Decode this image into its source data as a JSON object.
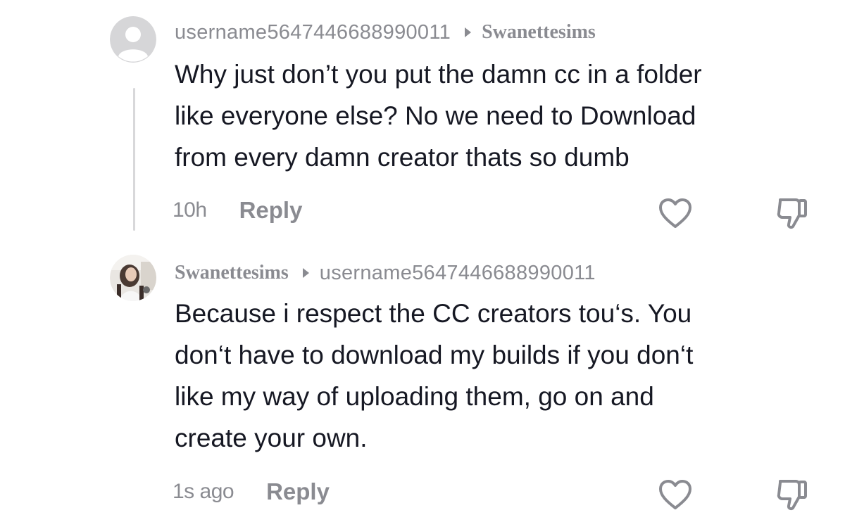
{
  "comments": [
    {
      "author": "username5647446688990011",
      "reply_to": "Swanettesims",
      "text": "Why just don’t you put the damn cc in a folder\nlike everyone else? No we need to Download\nfrom every damn creator thats so dumb",
      "time": "10h",
      "reply_label": "Reply",
      "avatar": "default-avatar"
    },
    {
      "author": "Swanettesims",
      "reply_to": "username5647446688990011",
      "text": "Because i respect the CC creators tou‘s. You\ndon‘t have to download my builds if you don‘t\nlike my way of uploading them, go on and\ncreate your own.",
      "time": "1s ago",
      "reply_label": "Reply",
      "avatar": "photo-avatar"
    }
  ],
  "icons": {
    "like": "heart-outline-icon",
    "dislike": "thumbs-down-outline-icon",
    "reply_arrow": "triangle-right-icon"
  },
  "colors": {
    "text_primary": "#161823",
    "text_secondary": "#8a8b91",
    "thread_line": "#d8d8da",
    "default_avatar_bg": "#d6d6d8"
  }
}
